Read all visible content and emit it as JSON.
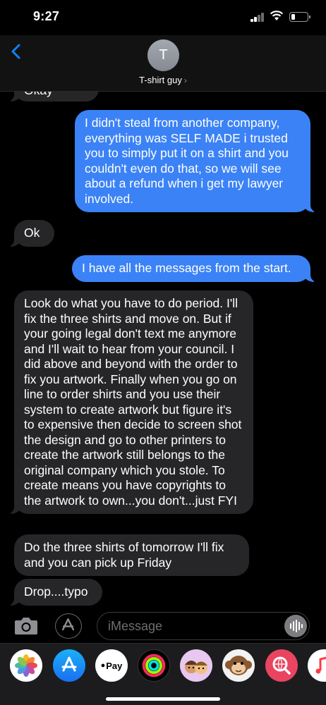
{
  "status_bar": {
    "time": "9:27"
  },
  "header": {
    "avatar_initial": "T",
    "contact_name": "T-shirt guy"
  },
  "messages": [
    {
      "side": "received",
      "text": "Okay"
    },
    {
      "side": "sent",
      "text": "I didn't steal from another company, everything was SELF MADE i trusted you to simply put it on a shirt and you couldn't even do that, so we will see about a refund when i get my lawyer involved."
    },
    {
      "side": "received",
      "text": "Ok"
    },
    {
      "side": "sent",
      "text": "I have all the messages from the start."
    },
    {
      "side": "received",
      "text": "Look do what you have to do period. I'll fix the three shirts and move on. But if your going legal don't text me anymore and I'll wait to hear from your council. I did above and beyond with the order to fix you artwork. Finally when you go on line to order shirts and you use their system to create artwork but figure it's to expensive then decide to screen shot the design and go to other printers to create the artwork still belongs to the original company which you stole. To create means you have copyrights to the artwork to own...you don't...just FYI"
    },
    {
      "side": "received",
      "text": "Do the three shirts of tomorrow I'll fix and you can pick up Friday"
    },
    {
      "side": "received",
      "text": "Drop....typo"
    }
  ],
  "compose": {
    "placeholder": "iMessage"
  },
  "app_drawer": {
    "apple_pay_label": "Pay",
    "apps": [
      "photos-icon",
      "app-store-icon",
      "apple-pay-icon",
      "activity-icon",
      "memoji-icon",
      "animoji-monkey-icon",
      "search-images-icon",
      "music-icon"
    ]
  },
  "colors": {
    "sent_bubble": "#3b82f6",
    "received_bubble": "#262628",
    "accent": "#0a84ff"
  }
}
